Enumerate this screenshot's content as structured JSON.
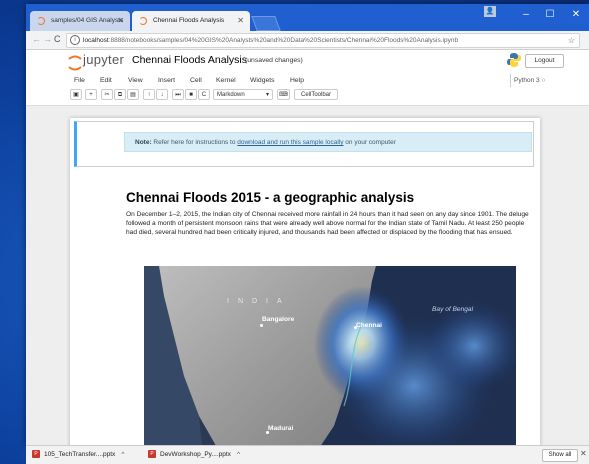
{
  "browser": {
    "tabs": [
      {
        "label": "samples/04 GIS Analysts"
      },
      {
        "label": "Chennai Floods Analysis"
      }
    ],
    "url": {
      "host": "localhost",
      "path": ":8888/notebooks/samples/04%20GIS%20Analysts%20and%20Data%20Scientists/Chennai%20Floods%20Analysis.ipynb"
    }
  },
  "jupyter": {
    "logo_text": "jupyter",
    "notebook_title": "Chennai Floods Analysis",
    "save_status": "(unsaved changes)",
    "logout_label": "Logout",
    "kernel": "Python 3",
    "menu": [
      "File",
      "Edit",
      "View",
      "Insert",
      "Cell",
      "Kernel",
      "Widgets",
      "Help"
    ],
    "toolbar": {
      "cell_type": "Markdown",
      "celltoolbar_label": "CellToolbar"
    }
  },
  "notebook": {
    "note": {
      "label": "Note:",
      "pre": "Refer here for instructions to",
      "link": "download and run this sample locally",
      "post": "on your computer"
    },
    "title": "Chennai Floods 2015 - a geographic analysis",
    "body": "On December 1–2, 2015, the Indian city of Chennai received more rainfall in 24 hours than it had seen on any day since 1901. The deluge followed a month of persistent monsoon rains that were already well above normal for the Indian state of Tamil Nadu. At least 250 people had died, several hundred had been critically injured, and thousands had been affected or displaced by the flooding that has ensued.",
    "map_labels": {
      "country": "INDIA",
      "city1": "Bangalore",
      "city2": "Chennai",
      "city3": "Madurai",
      "sea": "Bay of Bengal"
    }
  },
  "downloads": {
    "items": [
      {
        "label": "105_TechTransfer....pptx"
      },
      {
        "label": "DevWorkshop_Py....pptx"
      }
    ],
    "show_all_label": "Show all"
  },
  "colors": {
    "taskbar_blue": "#0b3e9a",
    "chrome_tab_blue": "#1f5fd0",
    "note_bg": "#d9edf7",
    "selected_cell_bar": "#42a5f5"
  }
}
